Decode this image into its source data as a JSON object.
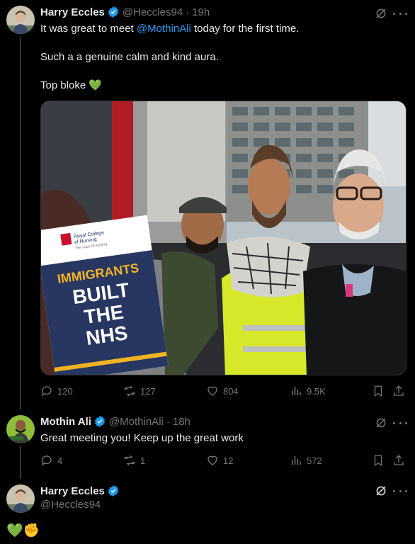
{
  "tweets": [
    {
      "name": "Harry Eccles",
      "handle": "@Heccles94",
      "time": "19h",
      "line1_pre": "It was great to meet ",
      "line1_mention": "@MothinAli",
      "line1_post": " today for the first time.",
      "line2": "Such a a genuine calm and kind aura.",
      "line3": "Top bloke 💚",
      "photo": {
        "sign_org_line1": "Royal College",
        "sign_org_line2": "of Nursing",
        "sign_org_tag": "The voice of nursing",
        "sign_word1": "IMMIGRANTS",
        "sign_word2": "BUILT",
        "sign_word3": "THE",
        "sign_word4": "NHS"
      },
      "stats": {
        "replies": "120",
        "reposts": "127",
        "likes": "804",
        "views": "9.5K"
      }
    },
    {
      "name": "Mothin Ali",
      "handle": "@MothinAli",
      "time": "18h",
      "text": "Great meeting you! Keep up the great work",
      "stats": {
        "replies": "4",
        "reposts": "1",
        "likes": "12",
        "views": "572"
      }
    },
    {
      "name": "Harry Eccles",
      "handle": "@Heccles94",
      "text": "💚✊"
    }
  ],
  "icons": [
    "grok-icon",
    "more-icon",
    "reply-icon",
    "repost-icon",
    "like-icon",
    "views-icon",
    "bookmark-icon",
    "share-icon",
    "verified-badge-icon"
  ],
  "colors": {
    "background": "#000000",
    "text": "#e7e9ea",
    "muted": "#71767b",
    "accent": "#1d9bf0",
    "divider": "#2f3336"
  }
}
